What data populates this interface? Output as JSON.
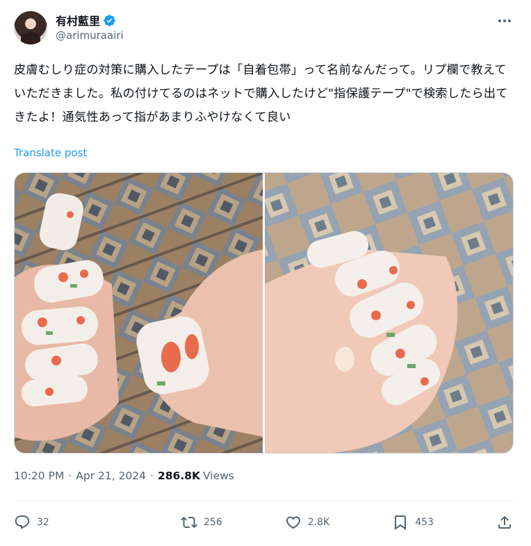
{
  "user": {
    "display_name": "有村藍里",
    "handle": "@arimuraairi",
    "verified_icon": "verified-badge-icon",
    "avatar_icon": "avatar"
  },
  "tweet": {
    "text": "皮膚むしり症の対策に購入したテープは「自着包帯」って名前なんだって。リプ欄で教えていただきました。私の付けてるのはネットで購入したけど\"指保護テープ\"で検索したら出てきたよ！通気性あって指があまりふやけなくて良い",
    "translate_label": "Translate post"
  },
  "meta": {
    "time": "10:20 PM",
    "date": "Apr 21, 2024",
    "separator": "·",
    "views_count": "286.8K",
    "views_label": "Views"
  },
  "actions": {
    "reply_count": "32",
    "retweet_count": "256",
    "like_count": "2.8K",
    "bookmark_count": "453"
  },
  "colors": {
    "accent": "#1d9bf0",
    "secondary_text": "#536471",
    "primary_text": "#0f1419"
  }
}
